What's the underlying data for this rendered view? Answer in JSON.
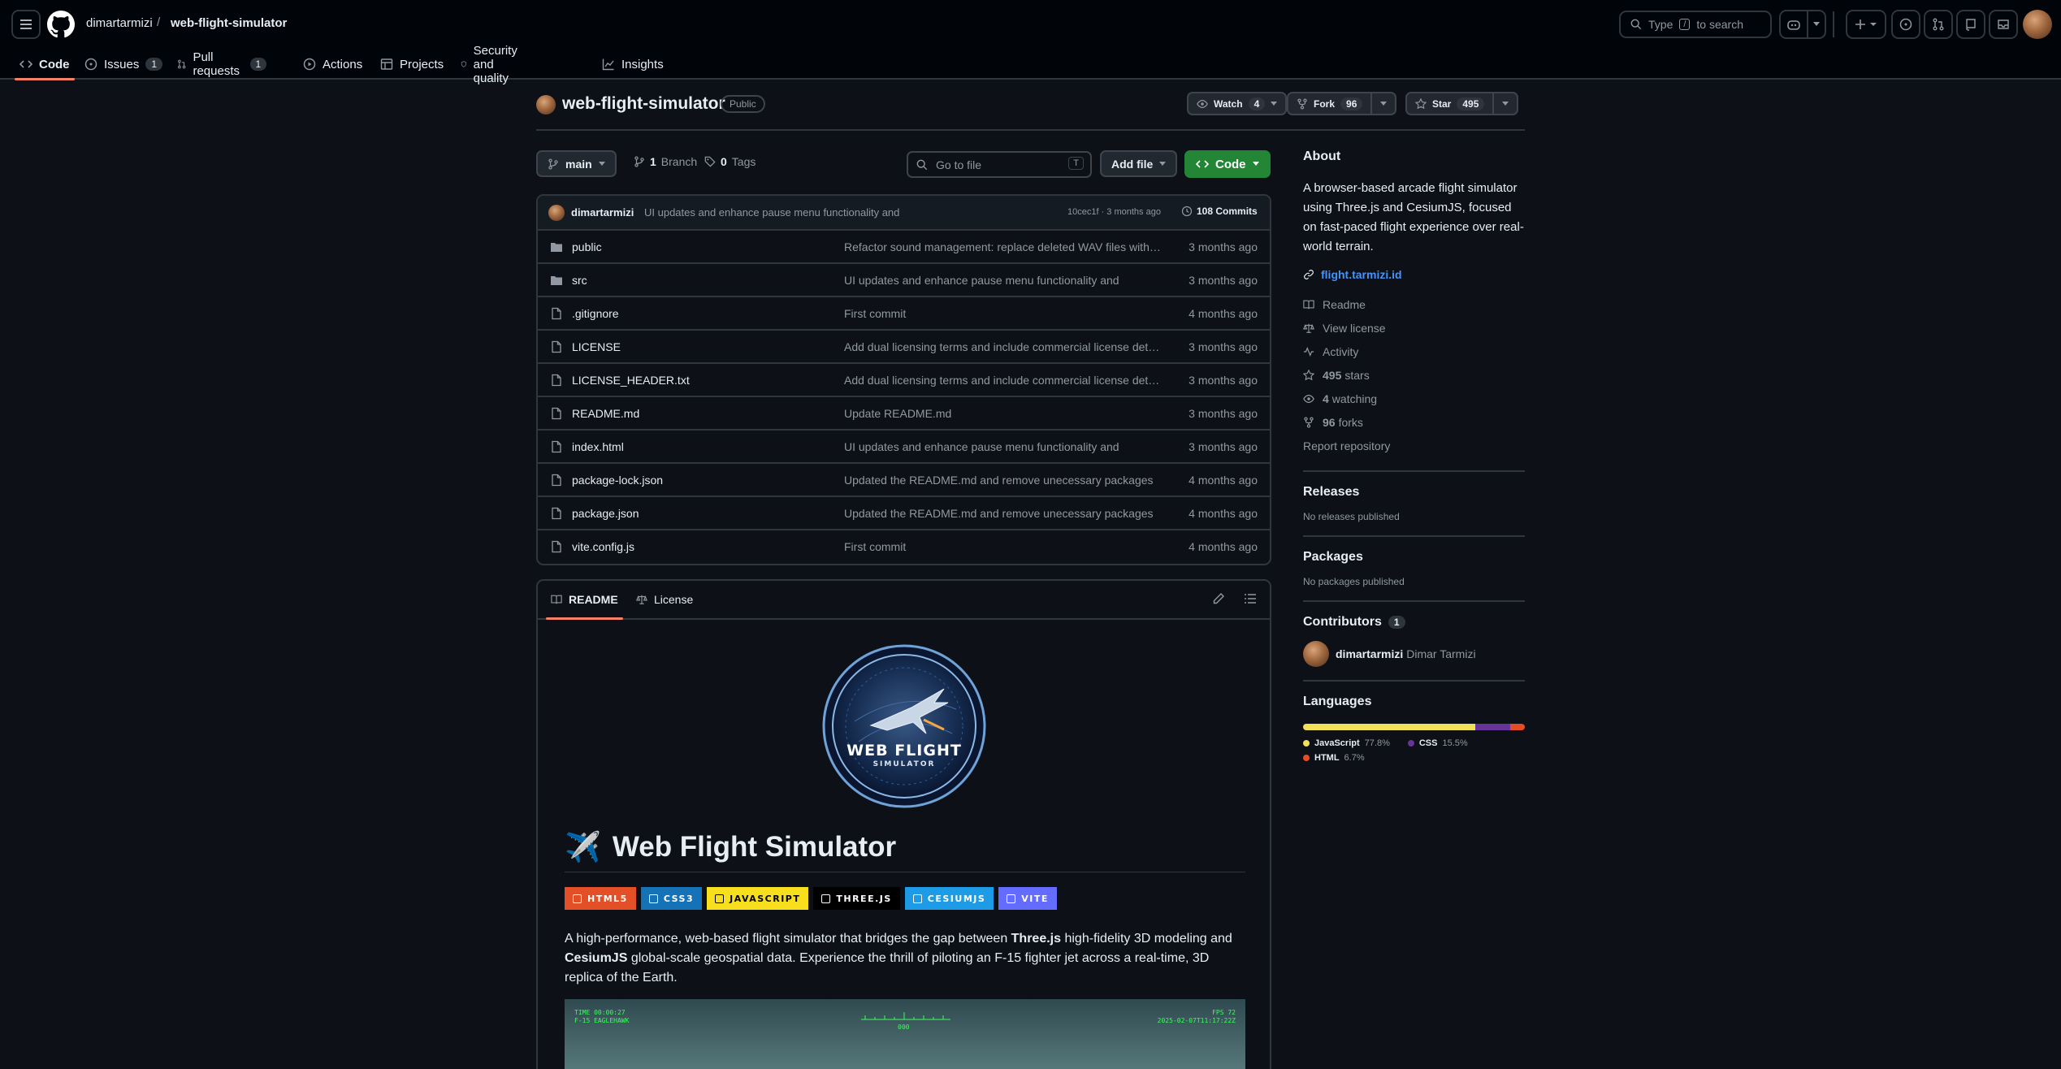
{
  "header": {
    "owner": "dimartarmizi",
    "separator": "/",
    "repo": "web-flight-simulator",
    "search_prefix": "Type",
    "search_key": "/",
    "search_suffix": "to search"
  },
  "nav": [
    {
      "label": "Code",
      "icon": "code-icon",
      "counter": ""
    },
    {
      "label": "Issues",
      "icon": "issue-icon",
      "counter": "1"
    },
    {
      "label": "Pull requests",
      "icon": "pull-request-icon",
      "counter": "1"
    },
    {
      "label": "Actions",
      "icon": "play-icon",
      "counter": ""
    },
    {
      "label": "Projects",
      "icon": "table-icon",
      "counter": ""
    },
    {
      "label": "Security and quality",
      "icon": "shield-icon",
      "counter": ""
    },
    {
      "label": "Insights",
      "icon": "graph-icon",
      "counter": ""
    }
  ],
  "repo": {
    "name": "web-flight-simulator",
    "visibility": "Public",
    "watch_label": "Watch",
    "watch_count": "4",
    "fork_label": "Fork",
    "fork_count": "96",
    "star_label": "Star",
    "star_count": "495"
  },
  "toolbar": {
    "branch": "main",
    "branches_count": "1",
    "branches_label": "Branch",
    "tags_count": "0",
    "tags_label": "Tags",
    "goto_placeholder": "Go to file",
    "goto_key": "T",
    "add_file": "Add file",
    "code": "Code"
  },
  "latest_commit": {
    "author": "dimartarmizi",
    "message": "UI updates and enhance pause menu functionality and",
    "meta": "10cec1f · 3 months ago",
    "commits": "108 Commits"
  },
  "files": [
    {
      "name": "public",
      "type": "dir",
      "message": "Refactor sound management: replace deleted WAV files with …",
      "date": "3 months ago"
    },
    {
      "name": "src",
      "type": "dir",
      "message": "UI updates and enhance pause menu functionality and",
      "date": "3 months ago"
    },
    {
      "name": ".gitignore",
      "type": "file",
      "message": "First commit",
      "date": "4 months ago"
    },
    {
      "name": "LICENSE",
      "type": "file",
      "message": "Add dual licensing terms and include commercial license det…",
      "date": "3 months ago"
    },
    {
      "name": "LICENSE_HEADER.txt",
      "type": "file",
      "message": "Add dual licensing terms and include commercial license det…",
      "date": "3 months ago"
    },
    {
      "name": "README.md",
      "type": "file",
      "message": "Update README.md",
      "date": "3 months ago"
    },
    {
      "name": "index.html",
      "type": "file",
      "message": "UI updates and enhance pause menu functionality and",
      "date": "3 months ago"
    },
    {
      "name": "package-lock.json",
      "type": "file",
      "message": "Updated the README.md and remove unecessary packages",
      "date": "4 months ago"
    },
    {
      "name": "package.json",
      "type": "file",
      "message": "Updated the README.md and remove unecessary packages",
      "date": "4 months ago"
    },
    {
      "name": "vite.config.js",
      "type": "file",
      "message": "First commit",
      "date": "4 months ago"
    }
  ],
  "readme": {
    "tab_readme": "README",
    "tab_license": "License",
    "logo_text": "WEB FLIGHT",
    "logo_subtext": "SIMULATOR",
    "title_emoji": "✈️",
    "title": "Web Flight Simulator",
    "badges": [
      {
        "label": "HTML5",
        "color": "#e34f26",
        "icon": "html5-icon"
      },
      {
        "label": "CSS3",
        "color": "#1572b6",
        "icon": "css3-icon"
      },
      {
        "label": "JAVASCRIPT",
        "color": "#f7df1e",
        "icon": "javascript-icon"
      },
      {
        "label": "THREE.JS",
        "color": "#000000",
        "icon": "threejs-icon"
      },
      {
        "label": "CESIUMJS",
        "color": "#1e9be6",
        "icon": "cesium-icon"
      },
      {
        "label": "VITE",
        "color": "#646cff",
        "icon": "vite-icon"
      }
    ],
    "intro_1": "A high-performance, web-based flight simulator that bridges the gap between ",
    "intro_threejs": "Three.js",
    "intro_2": " high-fidelity 3D modeling and ",
    "intro_cesium": "CesiumJS",
    "intro_3": " global-scale geospatial data. Experience the thrill of piloting an F-15 fighter jet across a real-time, 3D replica of the Earth.",
    "hud_tl_1": "TIME 00:00:27",
    "hud_tl_2": "F-15 EAGLEHAWK",
    "hud_center": "000",
    "hud_tr_1": "FPS 72",
    "hud_tr_2": "2025-02-07T11:17:22Z"
  },
  "sidebar": {
    "about_title": "About",
    "description": "A browser-based arcade flight simulator using Three.js and CesiumJS, focused on fast-paced flight experience over real-world terrain.",
    "website": "flight.tarmizi.id",
    "readme": "Readme",
    "license": "View license",
    "activity": "Activity",
    "stars_count": "495",
    "stars_label": "stars",
    "watching_count": "4",
    "watching_label": "watching",
    "forks_count": "96",
    "forks_label": "forks",
    "report": "Report repository",
    "releases_title": "Releases",
    "releases_text": "No releases published",
    "packages_title": "Packages",
    "packages_text": "No packages published",
    "contributors_title": "Contributors",
    "contributors_count": "1",
    "contributor_login": "dimartarmizi",
    "contributor_name": "Dimar Tarmizi",
    "languages_title": "Languages",
    "languages": [
      {
        "name": "JavaScript",
        "pct": "77.8%",
        "value": 77.8,
        "color": "#f1e05a"
      },
      {
        "name": "CSS",
        "pct": "15.5%",
        "value": 15.5,
        "color": "#663399"
      },
      {
        "name": "HTML",
        "pct": "6.7%",
        "value": 6.7,
        "color": "#e34c26"
      }
    ]
  }
}
